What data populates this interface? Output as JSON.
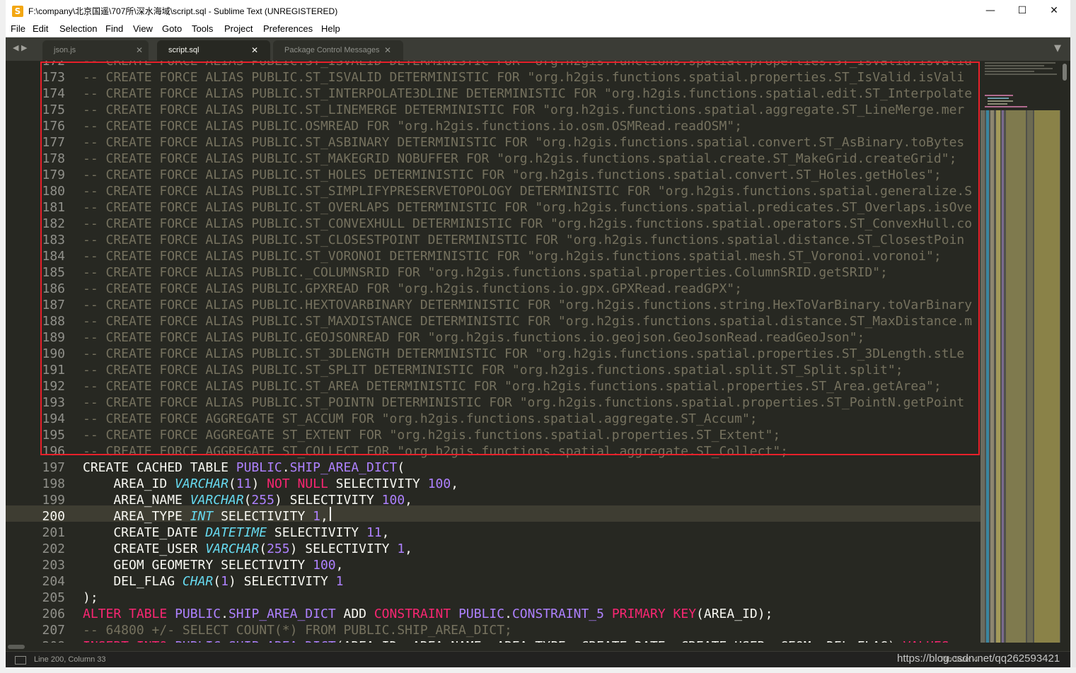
{
  "window": {
    "title": "F:\\company\\北京国遥\\707所\\深水海域\\script.sql - Sublime Text (UNREGISTERED)",
    "app_icon_glyph": "S",
    "minimize_glyph": "—",
    "maximize_glyph": "☐",
    "close_glyph": "✕"
  },
  "menu": [
    "File",
    "Edit",
    "Selection",
    "Find",
    "View",
    "Goto",
    "Tools",
    "Project",
    "Preferences",
    "Help"
  ],
  "tabs": [
    {
      "label": "json.js",
      "active": false
    },
    {
      "label": "script.sql",
      "active": true
    },
    {
      "label": "Package Control Messages",
      "active": false
    }
  ],
  "tab_close_glyph": "✕",
  "tab_dropdown_glyph": "▼",
  "nav_arrows": "◀ ▶",
  "editor": {
    "current_line": 200,
    "lines": [
      {
        "n": "172",
        "tokens": [
          [
            "c",
            "-- CREATE FORCE ALIAS PUBLIC.ST_ISVALID DETERMINISTIC FOR \"org.h2gis.functions.spatial.properties.ST_IsValid.isValid\";"
          ]
        ]
      },
      {
        "n": "173",
        "tokens": [
          [
            "c",
            "-- CREATE FORCE ALIAS PUBLIC.ST_ISVALID DETERMINISTIC FOR \"org.h2gis.functions.spatial.properties.ST_IsValid.isVali"
          ]
        ]
      },
      {
        "n": "174",
        "tokens": [
          [
            "c",
            "-- CREATE FORCE ALIAS PUBLIC.ST_INTERPOLATE3DLINE DETERMINISTIC FOR \"org.h2gis.functions.spatial.edit.ST_Interpolate"
          ]
        ]
      },
      {
        "n": "175",
        "tokens": [
          [
            "c",
            "-- CREATE FORCE ALIAS PUBLIC.ST_LINEMERGE DETERMINISTIC FOR \"org.h2gis.functions.spatial.aggregate.ST_LineMerge.mer"
          ]
        ]
      },
      {
        "n": "176",
        "tokens": [
          [
            "c",
            "-- CREATE FORCE ALIAS PUBLIC.OSMREAD FOR \"org.h2gis.functions.io.osm.OSMRead.readOSM\";"
          ]
        ]
      },
      {
        "n": "177",
        "tokens": [
          [
            "c",
            "-- CREATE FORCE ALIAS PUBLIC.ST_ASBINARY DETERMINISTIC FOR \"org.h2gis.functions.spatial.convert.ST_AsBinary.toBytes"
          ]
        ]
      },
      {
        "n": "178",
        "tokens": [
          [
            "c",
            "-- CREATE FORCE ALIAS PUBLIC.ST_MAKEGRID NOBUFFER FOR \"org.h2gis.functions.spatial.create.ST_MakeGrid.createGrid\";"
          ]
        ]
      },
      {
        "n": "179",
        "tokens": [
          [
            "c",
            "-- CREATE FORCE ALIAS PUBLIC.ST_HOLES DETERMINISTIC FOR \"org.h2gis.functions.spatial.convert.ST_Holes.getHoles\";"
          ]
        ]
      },
      {
        "n": "180",
        "tokens": [
          [
            "c",
            "-- CREATE FORCE ALIAS PUBLIC.ST_SIMPLIFYPRESERVETOPOLOGY DETERMINISTIC FOR \"org.h2gis.functions.spatial.generalize.S"
          ]
        ]
      },
      {
        "n": "181",
        "tokens": [
          [
            "c",
            "-- CREATE FORCE ALIAS PUBLIC.ST_OVERLAPS DETERMINISTIC FOR \"org.h2gis.functions.spatial.predicates.ST_Overlaps.isOve"
          ]
        ]
      },
      {
        "n": "182",
        "tokens": [
          [
            "c",
            "-- CREATE FORCE ALIAS PUBLIC.ST_CONVEXHULL DETERMINISTIC FOR \"org.h2gis.functions.spatial.operators.ST_ConvexHull.co"
          ]
        ]
      },
      {
        "n": "183",
        "tokens": [
          [
            "c",
            "-- CREATE FORCE ALIAS PUBLIC.ST_CLOSESTPOINT DETERMINISTIC FOR \"org.h2gis.functions.spatial.distance.ST_ClosestPoin"
          ]
        ]
      },
      {
        "n": "184",
        "tokens": [
          [
            "c",
            "-- CREATE FORCE ALIAS PUBLIC.ST_VORONOI DETERMINISTIC FOR \"org.h2gis.functions.spatial.mesh.ST_Voronoi.voronoi\";"
          ]
        ]
      },
      {
        "n": "185",
        "tokens": [
          [
            "c",
            "-- CREATE FORCE ALIAS PUBLIC._COLUMNSRID FOR \"org.h2gis.functions.spatial.properties.ColumnSRID.getSRID\";"
          ]
        ]
      },
      {
        "n": "186",
        "tokens": [
          [
            "c",
            "-- CREATE FORCE ALIAS PUBLIC.GPXREAD FOR \"org.h2gis.functions.io.gpx.GPXRead.readGPX\";"
          ]
        ]
      },
      {
        "n": "187",
        "tokens": [
          [
            "c",
            "-- CREATE FORCE ALIAS PUBLIC.HEXTOVARBINARY DETERMINISTIC FOR \"org.h2gis.functions.string.HexToVarBinary.toVarBinary"
          ]
        ]
      },
      {
        "n": "188",
        "tokens": [
          [
            "c",
            "-- CREATE FORCE ALIAS PUBLIC.ST_MAXDISTANCE DETERMINISTIC FOR \"org.h2gis.functions.spatial.distance.ST_MaxDistance.m"
          ]
        ]
      },
      {
        "n": "189",
        "tokens": [
          [
            "c",
            "-- CREATE FORCE ALIAS PUBLIC.GEOJSONREAD FOR \"org.h2gis.functions.io.geojson.GeoJsonRead.readGeoJson\";"
          ]
        ]
      },
      {
        "n": "190",
        "tokens": [
          [
            "c",
            "-- CREATE FORCE ALIAS PUBLIC.ST_3DLENGTH DETERMINISTIC FOR \"org.h2gis.functions.spatial.properties.ST_3DLength.stLe"
          ]
        ]
      },
      {
        "n": "191",
        "tokens": [
          [
            "c",
            "-- CREATE FORCE ALIAS PUBLIC.ST_SPLIT DETERMINISTIC FOR \"org.h2gis.functions.spatial.split.ST_Split.split\";"
          ]
        ]
      },
      {
        "n": "192",
        "tokens": [
          [
            "c",
            "-- CREATE FORCE ALIAS PUBLIC.ST_AREA DETERMINISTIC FOR \"org.h2gis.functions.spatial.properties.ST_Area.getArea\";"
          ]
        ]
      },
      {
        "n": "193",
        "tokens": [
          [
            "c",
            "-- CREATE FORCE ALIAS PUBLIC.ST_POINTN DETERMINISTIC FOR \"org.h2gis.functions.spatial.properties.ST_PointN.getPoint"
          ]
        ]
      },
      {
        "n": "194",
        "tokens": [
          [
            "c",
            "-- CREATE FORCE AGGREGATE ST_ACCUM FOR \"org.h2gis.functions.spatial.aggregate.ST_Accum\";"
          ]
        ]
      },
      {
        "n": "195",
        "tokens": [
          [
            "c",
            "-- CREATE FORCE AGGREGATE ST_EXTENT FOR \"org.h2gis.functions.spatial.properties.ST_Extent\";"
          ]
        ]
      },
      {
        "n": "196",
        "tokens": [
          [
            "c",
            "-- CREATE FORCE AGGREGATE ST_COLLECT FOR \"org.h2gis.functions.spatial.aggregate.ST_Collect\";"
          ]
        ]
      },
      {
        "n": "197",
        "tokens": [
          [
            "p",
            "CREATE CACHED TABLE "
          ],
          [
            "n",
            "PUBLIC"
          ],
          [
            "p",
            "."
          ],
          [
            "n",
            "SHIP_AREA_DICT"
          ],
          [
            "p",
            "("
          ]
        ]
      },
      {
        "n": "198",
        "tokens": [
          [
            "p",
            "    AREA_ID "
          ],
          [
            "t",
            "VARCHAR"
          ],
          [
            "p",
            "("
          ],
          [
            "n",
            "11"
          ],
          [
            "p",
            ") "
          ],
          [
            "k",
            "NOT NULL"
          ],
          [
            "p",
            " SELECTIVITY "
          ],
          [
            "n",
            "100"
          ],
          [
            "p",
            ","
          ]
        ]
      },
      {
        "n": "199",
        "tokens": [
          [
            "p",
            "    AREA_NAME "
          ],
          [
            "t",
            "VARCHAR"
          ],
          [
            "p",
            "("
          ],
          [
            "n",
            "255"
          ],
          [
            "p",
            ") SELECTIVITY "
          ],
          [
            "n",
            "100"
          ],
          [
            "p",
            ","
          ]
        ]
      },
      {
        "n": "200",
        "tokens": [
          [
            "p",
            "    AREA_TYPE "
          ],
          [
            "t",
            "INT"
          ],
          [
            "p",
            " SELECTIVITY "
          ],
          [
            "n",
            "1"
          ],
          [
            "p",
            ","
          ]
        ]
      },
      {
        "n": "201",
        "tokens": [
          [
            "p",
            "    CREATE_DATE "
          ],
          [
            "t",
            "DATETIME"
          ],
          [
            "p",
            " SELECTIVITY "
          ],
          [
            "n",
            "11"
          ],
          [
            "p",
            ","
          ]
        ]
      },
      {
        "n": "202",
        "tokens": [
          [
            "p",
            "    CREATE_USER "
          ],
          [
            "t",
            "VARCHAR"
          ],
          [
            "p",
            "("
          ],
          [
            "n",
            "255"
          ],
          [
            "p",
            ") SELECTIVITY "
          ],
          [
            "n",
            "1"
          ],
          [
            "p",
            ","
          ]
        ]
      },
      {
        "n": "203",
        "tokens": [
          [
            "p",
            "    GEOM GEOMETRY SELECTIVITY "
          ],
          [
            "n",
            "100"
          ],
          [
            "p",
            ","
          ]
        ]
      },
      {
        "n": "204",
        "tokens": [
          [
            "p",
            "    DEL_FLAG "
          ],
          [
            "t",
            "CHAR"
          ],
          [
            "p",
            "("
          ],
          [
            "n",
            "1"
          ],
          [
            "p",
            ") SELECTIVITY "
          ],
          [
            "n",
            "1"
          ]
        ]
      },
      {
        "n": "205",
        "tokens": [
          [
            "p",
            ");"
          ]
        ]
      },
      {
        "n": "206",
        "tokens": [
          [
            "k",
            "ALTER TABLE"
          ],
          [
            "p",
            " "
          ],
          [
            "n",
            "PUBLIC"
          ],
          [
            "p",
            "."
          ],
          [
            "n",
            "SHIP_AREA_DICT"
          ],
          [
            "p",
            " ADD "
          ],
          [
            "k",
            "CONSTRAINT"
          ],
          [
            "p",
            " "
          ],
          [
            "n",
            "PUBLIC"
          ],
          [
            "p",
            "."
          ],
          [
            "n",
            "CONSTRAINT_5"
          ],
          [
            "p",
            " "
          ],
          [
            "k",
            "PRIMARY KEY"
          ],
          [
            "p",
            "(AREA_ID);"
          ]
        ]
      },
      {
        "n": "207",
        "tokens": [
          [
            "c",
            "-- 64800 +/- SELECT COUNT(*) FROM PUBLIC.SHIP_AREA_DICT;"
          ]
        ]
      },
      {
        "n": "208",
        "tokens": [
          [
            "k",
            "INSERT INTO"
          ],
          [
            "p",
            " "
          ],
          [
            "n",
            "PUBLIC"
          ],
          [
            "p",
            "."
          ],
          [
            "n",
            "SHIP_AREA_DICT"
          ],
          [
            "p",
            "(AREA_ID, AREA_NAME, AREA_TYPE, CREATE_DATE, CREATE_USER, GEOM, DEL_FLAG) "
          ],
          [
            "k",
            "VALUES"
          ]
        ]
      }
    ]
  },
  "status": {
    "position": "Line 200, Column 33",
    "right_text": "Tab Size: 4"
  },
  "watermark": "https://blog.csdn.net/qq262593421",
  "colors": {
    "editor_bg": "#272822",
    "comment": "#75715e",
    "keyword": "#f92672",
    "type": "#66d9ef",
    "number": "#ae81ff",
    "annotation_box": "#e8202a"
  }
}
